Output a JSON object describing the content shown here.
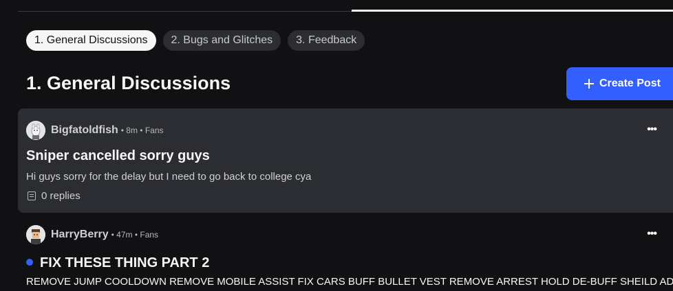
{
  "categories": [
    {
      "label": "1. General Discussions",
      "active": true
    },
    {
      "label": "2. Bugs and Glitches",
      "active": false
    },
    {
      "label": "3. Feedback",
      "active": false
    }
  ],
  "heading": "1. General Discussions",
  "create_button": {
    "label": "Create Post"
  },
  "posts": [
    {
      "username": "Bigfatoldfish",
      "meta": "• 8m • Fans",
      "title": "Sniper cancelled sorry guys",
      "body": "Hi guys sorry for the delay but I need to go back to college cya",
      "replies": "0 replies",
      "unread": false
    },
    {
      "username": "HarryBerry",
      "meta": "• 47m • Fans",
      "title": "FIX THESE THING PART 2",
      "body": "REMOVE JUMP COOLDOWN REMOVE MOBILE ASSIST FIX CARS BUFF BULLET VEST REMOVE ARREST HOLD DE-BUFF SHEILD ADD",
      "unread": true
    }
  ],
  "colors": {
    "background": "#111113",
    "card": "#2b2d33",
    "accent": "#335fff",
    "chip_active": "#f7f7f8"
  },
  "icons": {
    "create": "plus-icon",
    "more": "more-options-icon",
    "replies": "replies-icon",
    "unread": "unread-dot-icon"
  }
}
